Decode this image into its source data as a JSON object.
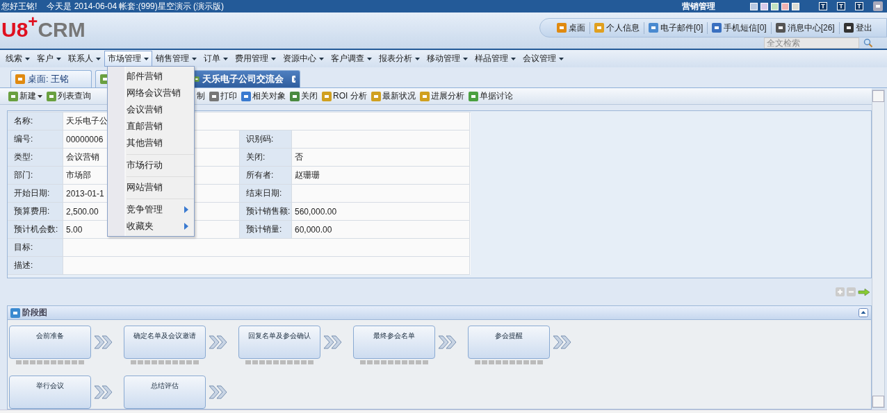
{
  "top_bar": {
    "greeting": "您好王铭!",
    "date_info": "今天是  2014-06-04 帐套:(999)星空演示 (演示版)",
    "module": "营销管理",
    "theme_swatches": [
      {
        "color": "#b9c9e2"
      },
      {
        "color": "#d9cbea"
      },
      {
        "color": "#c2e2c0"
      },
      {
        "color": "#f0b2b2"
      },
      {
        "color": "#dcdcd4"
      }
    ],
    "font_buttons": [
      "T",
      "T",
      "T"
    ]
  },
  "header": {
    "logo_main": "U8",
    "logo_plus": "+",
    "logo_crm": "CRM",
    "links": [
      "桌面",
      "个人信息",
      "电子邮件[0]",
      "手机短信[0]",
      "消息中心[26]",
      "登出"
    ],
    "search": {
      "placeholder": "全文检索"
    }
  },
  "menu": [
    {
      "label": "线索",
      "selected": false
    },
    {
      "label": "客户",
      "selected": false
    },
    {
      "label": "联系人",
      "selected": false
    },
    {
      "label": "市场管理",
      "selected": true
    },
    {
      "label": "销售管理",
      "selected": false
    },
    {
      "label": "订单",
      "selected": false
    },
    {
      "label": "费用管理",
      "selected": false
    },
    {
      "label": "资源中心",
      "selected": false
    },
    {
      "label": "客户调查",
      "selected": false
    },
    {
      "label": "报表分析",
      "selected": false
    },
    {
      "label": "移动管理",
      "selected": false
    },
    {
      "label": "样品管理",
      "selected": false
    },
    {
      "label": "会议管理",
      "selected": false
    }
  ],
  "dropdown": [
    [
      {
        "label": "邮件营销",
        "submenu": false
      },
      {
        "label": "网络会议营销",
        "submenu": false
      },
      {
        "label": "会议营销",
        "submenu": false
      },
      {
        "label": "直邮营销",
        "submenu": false
      },
      {
        "label": "其他营销",
        "submenu": false
      }
    ],
    [
      {
        "label": "市场行动",
        "submenu": false
      }
    ],
    [
      {
        "label": "网站营销",
        "submenu": false
      }
    ],
    [
      {
        "label": "竞争管理",
        "submenu": true
      },
      {
        "label": "收藏夹",
        "submenu": true
      }
    ]
  ],
  "tabs": [
    {
      "label": "桌面: 王铭",
      "selected": false,
      "closable": false
    },
    {
      "selected": false
    },
    {
      "label": "天乐电子公司交流会",
      "selected": true,
      "closable": true
    }
  ],
  "toolbar": [
    {
      "label": "新建",
      "caret": true
    },
    {
      "label": "列表查询",
      "caret": false
    },
    {
      "label": "制",
      "caret": false
    },
    {
      "label": "打印",
      "caret": false
    },
    {
      "label": "相关对象",
      "caret": false
    },
    {
      "label": "关闭",
      "caret": false
    },
    {
      "label": "ROI 分析",
      "caret": false
    },
    {
      "label": "最新状况",
      "caret": false
    },
    {
      "label": "进展分析",
      "caret": false
    },
    {
      "label": "单据讨论",
      "caret": false
    }
  ],
  "form": [
    {
      "label": "名称:",
      "value": "天乐电子公",
      "wide": true
    },
    {
      "label": "编号:",
      "value": "00000006",
      "label2": "识别码:",
      "wide": false
    },
    {
      "label": "类型:",
      "value": "会议营销",
      "label2": "关闭:",
      "value2": "否",
      "wide": false
    },
    {
      "label": "部门:",
      "value": "市场部",
      "label2": "所有者:",
      "value2": "赵珊珊",
      "wide": false
    },
    {
      "label": "开始日期:",
      "value": "2013-01-1",
      "label2": "结束日期:",
      "wide": false
    },
    {
      "label": "预算费用:",
      "value": "2,500.00",
      "label2": "预计销售额:",
      "value2": "560,000.00",
      "wide": false
    },
    {
      "label": "预计机会数:",
      "value": "5.00",
      "label2": "预计销量:",
      "value2": "60,000.00",
      "wide": false
    },
    {
      "label": "目标:",
      "wide": true
    },
    {
      "label": "描述:",
      "wide": true
    }
  ],
  "stage_panel": {
    "title": "阶段图",
    "stages": [
      {
        "label": "会前准备",
        "dots": true
      },
      {
        "label": "确定名单及会议邀请",
        "dots": true
      },
      {
        "label": "回复名单及参会确认",
        "dots": true
      },
      {
        "label": "最终参会名单",
        "dots": true
      },
      {
        "label": "参会提醒",
        "dots": true
      },
      {
        "label": "举行会议",
        "dots": false
      },
      {
        "label": "总结评估",
        "dots": false
      }
    ]
  }
}
